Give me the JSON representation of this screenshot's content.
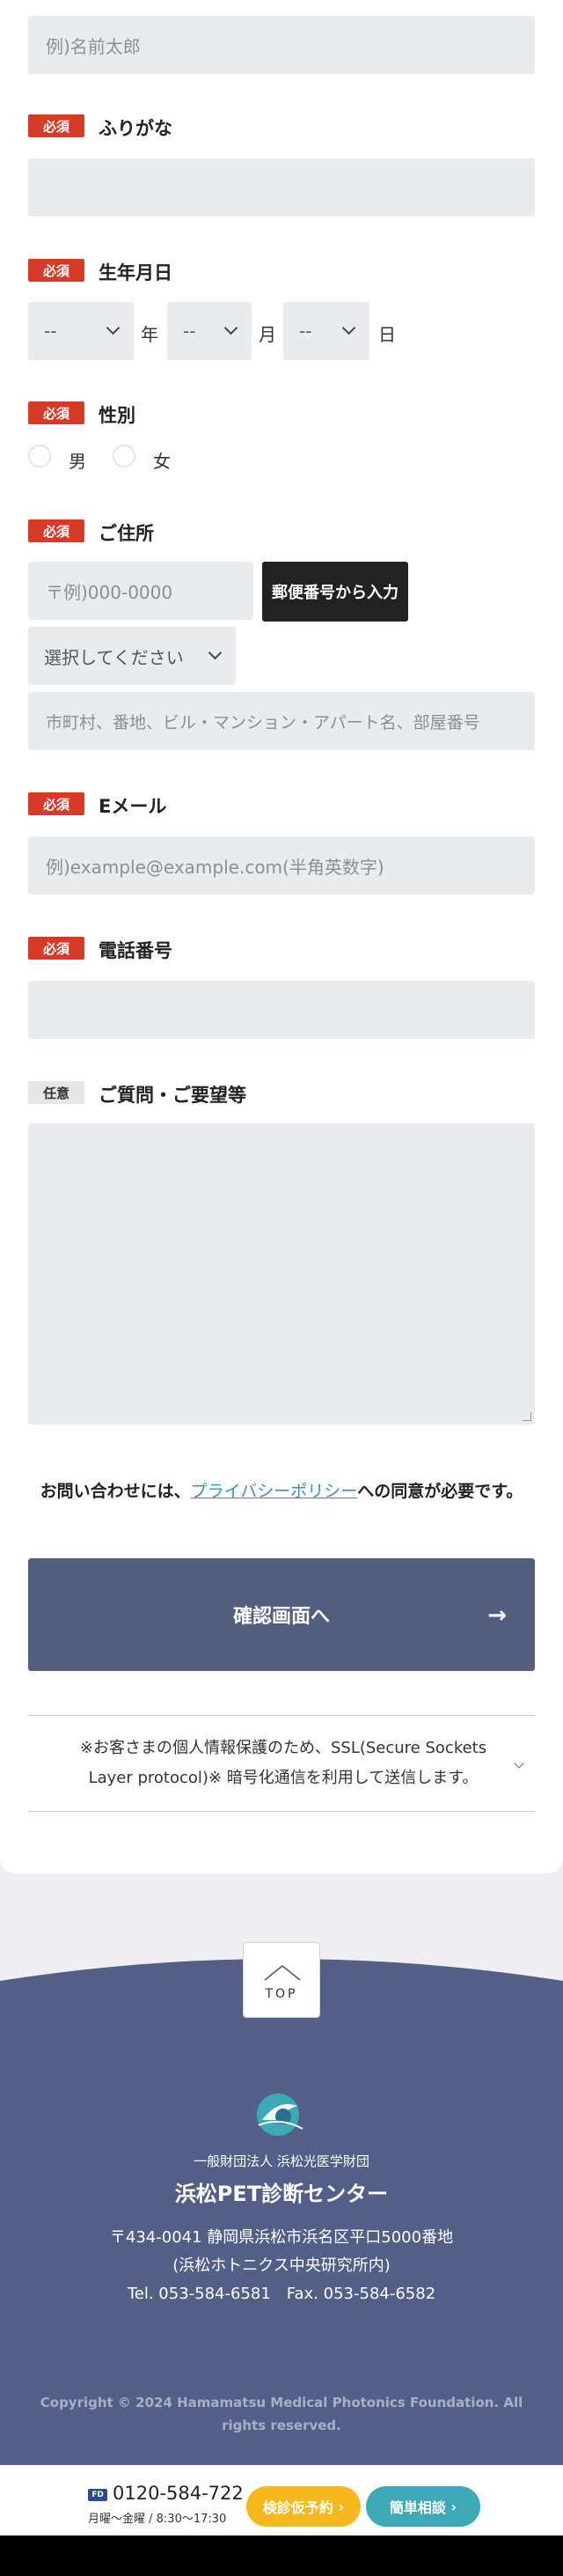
{
  "form": {
    "name_placeholder": "例)名前太郎",
    "required_badge": "必須",
    "optional_badge": "任意",
    "furigana_label": "ふりがな",
    "birth_label": "生年月日",
    "birth_year_value": "--",
    "birth_month_value": "--",
    "birth_day_value": "--",
    "year_unit": "年",
    "month_unit": "月",
    "day_unit": "日",
    "gender_label": "性別",
    "gender_male": "男",
    "gender_female": "女",
    "address_label": "ご住所",
    "zip_placeholder": "〒例)000-0000",
    "zip_button": "郵便番号から入力",
    "prefecture_value": "選択してください",
    "address_placeholder": "市町村、番地、ビル・マンション・アパート名、部屋番号",
    "email_label": "Eメール",
    "email_placeholder": "例)example@example.com(半角英数字)",
    "phone_label": "電話番号",
    "inquiry_label": "ご質問・ご要望等"
  },
  "agree": {
    "prefix": "お問い合わせには、",
    "link": "プライバシーポリシー",
    "suffix": "への同意が必要です。"
  },
  "confirm_button": "確認画面へ",
  "ssl_note": "※お客さまの個人情報保護のため、SSL(Secure Sockets Layer protocol)※ 暗号化通信を利用して送信します。",
  "top_button": "TOP",
  "footer": {
    "org_sub": "一般財団法人 浜松光医学財団",
    "org_name": "浜松PET診断センター",
    "address_line1": "〒434-0041 静岡県浜松市浜名区平口5000番地",
    "address_line2": "(浜松ホトニクス中央研究所内)",
    "address_line3": "Tel. 053-584-6581　Fax. 053-584-6582",
    "copyright": "Copyright © 2024 Hamamatsu Medical Photonics Foundation. All rights reserved."
  },
  "bottom_bar": {
    "freedial_icon": "FD",
    "phone": "0120-584-722",
    "hours": "月曜〜金曜 / 8:30〜17:30",
    "reserve_button": "検診仮予約",
    "consult_button": "簡単相談"
  },
  "colors": {
    "required": "#d63b2a",
    "navy": "#535f86",
    "yellow": "#f5b91f",
    "teal": "#3ea9b6"
  }
}
